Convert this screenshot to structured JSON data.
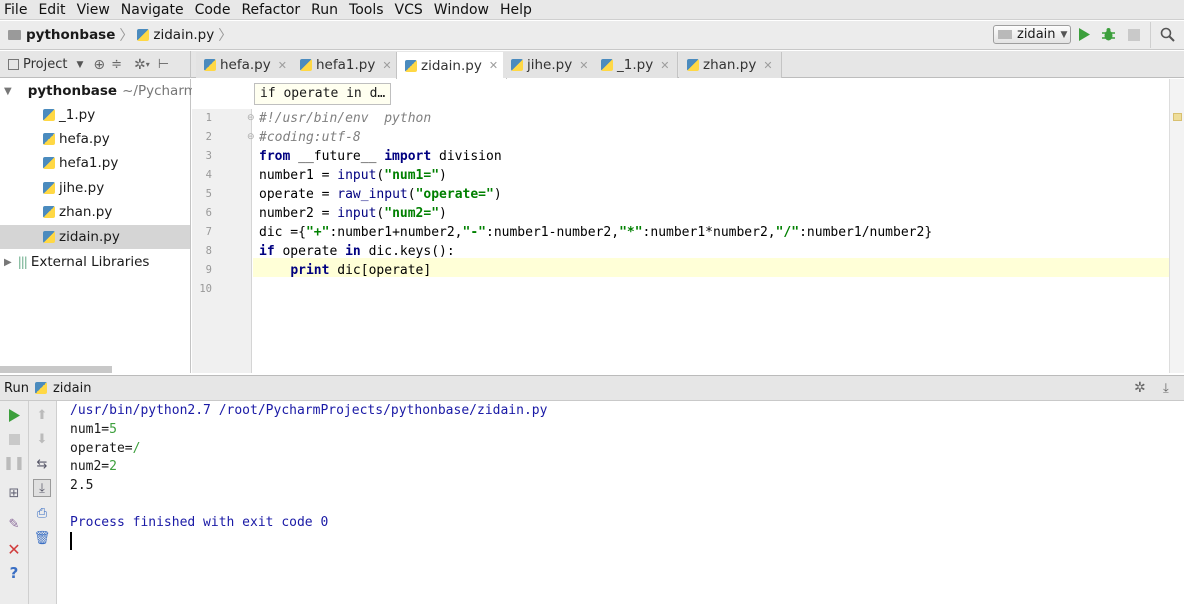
{
  "menu": [
    "File",
    "Edit",
    "View",
    "Navigate",
    "Code",
    "Refactor",
    "Run",
    "Tools",
    "VCS",
    "Window",
    "Help"
  ],
  "nav": {
    "project": "pythonbase",
    "file": "zidain.py",
    "run_config": "zidain"
  },
  "project_panel": {
    "header": "Project",
    "root_label": "pythonbase",
    "root_path": "~/Pycharm",
    "files": [
      "_1.py",
      "hefa.py",
      "hefa1.py",
      "jihe.py",
      "zhan.py",
      "zidain.py"
    ],
    "selected_file": "zidain.py",
    "external": "External Libraries"
  },
  "tabs": [
    {
      "label": "hefa.py",
      "active": false
    },
    {
      "label": "hefa1.py",
      "active": false
    },
    {
      "label": "zidain.py",
      "active": true
    },
    {
      "label": "jihe.py",
      "active": false
    },
    {
      "label": "_1.py",
      "active": false
    },
    {
      "label": "zhan.py",
      "active": false
    }
  ],
  "editor": {
    "breadcrumb_popup": "if operate in d…",
    "line_numbers": [
      "1",
      "2",
      "3",
      "4",
      "5",
      "6",
      "7",
      "8",
      "9",
      "10"
    ],
    "current_line": 9
  },
  "run": {
    "title": "Run",
    "config": "zidain",
    "console": {
      "command": "/usr/bin/python2.7 /root/PycharmProjects/pythonbase/zidain.py",
      "prompt1": "num1=",
      "input1": "5",
      "prompt2": "operate=",
      "input2": "/",
      "prompt3": "num2=",
      "input3": "2",
      "result": "2.5",
      "finished": "Process finished with exit code 0"
    }
  },
  "colors": {
    "keyword": "#000080",
    "string": "#008000",
    "comment": "#808080",
    "run_green": "#3c9f3c",
    "stop_red": "#d13d3d",
    "console_blue": "#1a1aa6"
  }
}
